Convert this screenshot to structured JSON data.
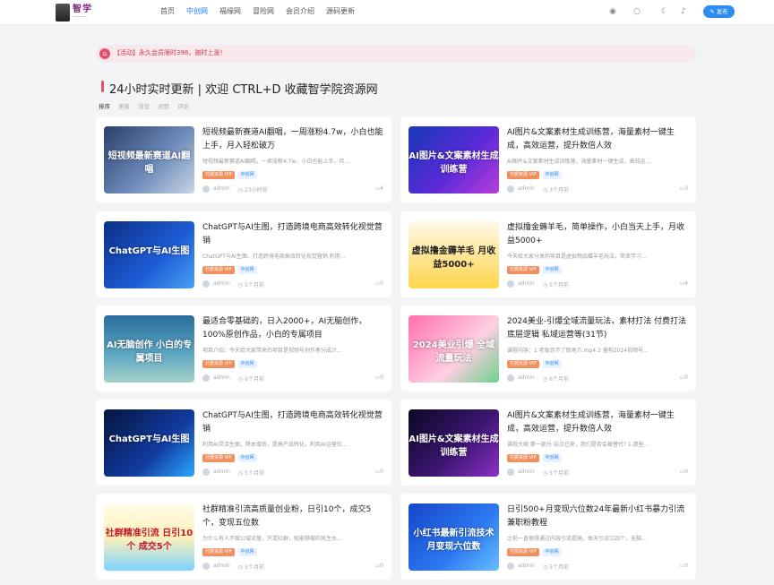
{
  "header": {
    "nav": [
      "首页",
      "中创网",
      "福缘网",
      "冒险网",
      "会员介绍",
      "源码更新"
    ],
    "active_nav_index": 1,
    "post_button": "发布",
    "icons": [
      "user-icon",
      "search-icon",
      "moon-icon",
      "bell-icon"
    ]
  },
  "notice": {
    "text": "【活动】永久会员限时398，随时上涨！"
  },
  "section": {
    "title": "24小时实时更新 | 欢迎 CTRL+D 收藏智学院资源网",
    "sorts": [
      "排序",
      "更新",
      "浏览",
      "点赞",
      "评论"
    ]
  },
  "posts": [
    {
      "title": "短视频最新赛道AI翻唱，一周涨粉4.7w，小白也能上手，月入轻松破万",
      "thumb": "短视频最新赛道AI翻唱",
      "desc": "短视频最新赛道AI翻唱，一周涨粉4.7w，小白也能上手，月...",
      "tag1": "付费资源 VIP",
      "tag2": "中创网",
      "author": "admin",
      "time": "23小时前",
      "count": "4"
    },
    {
      "title": "AI图片&文案素材生成训练营，海量素材一键生成，高效运营，提升数倍人效",
      "thumb": "AI图片&文案素材生成训练营",
      "desc": "AI图片&文案素材生成训练营，海量素材一键生成，高效运...",
      "tag1": "付费资源 VIP",
      "tag2": "中创网",
      "author": "admin",
      "time": "3个月前",
      "count": "3"
    },
    {
      "title": "ChatGPT与AI生图，打造跨境电商高效转化视觉营销",
      "thumb": "ChatGPT与AI生图",
      "desc": "ChatGPT与AI生图，打造跨境电商高效转化视觉营销 利用...",
      "tag1": "付费资源 VIP",
      "tag2": "中创网",
      "author": "admin",
      "time": "5个月前",
      "count": "0"
    },
    {
      "title": "虚拟撸金薅羊毛，简单操作，小白当天上手，月收益5000+",
      "thumb": "虚拟撸金薅羊毛 月收益5000+",
      "desc": "今天给大家分享的项目是虚拟物品薅羊毛玩法，简单学习...",
      "tag1": "付费资源 VIP",
      "tag2": "中创网",
      "author": "admin",
      "time": "5个月前",
      "count": "4"
    },
    {
      "title": "最适合零基础的，日入2000+，AI无脑创作，100%原创作品，小白的专属项目",
      "thumb": "AI无脑创作 小白的专属项目",
      "desc": "项目介绍：今天给大家带来的项目是视频号创作者分成计...",
      "tag1": "付费资源 VIP",
      "tag2": "中创网",
      "author": "admin",
      "time": "6个月前",
      "count": "0"
    },
    {
      "title": "2024美业-引爆全域流量玩法，素材打法 付费打法 底层逻辑 私域运营等(31节)",
      "thumb": "2024美业引爆 全域流量玩法",
      "desc": "课程内容：1 老板到不了新地方.mp4 2 量构2024视频号...",
      "tag1": "付费资源 VIP",
      "tag2": "中创网",
      "author": "admin",
      "time": "6个月前",
      "count": "0"
    },
    {
      "title": "ChatGPT与AI生图，打造跨境电商高效转化视觉营销",
      "thumb": "ChatGPT与AI生图",
      "desc": "利用AI灵活生图，降本增效，提高产品转化，利用AI运营社...",
      "tag1": "付费资源 VIP",
      "tag2": "中创网",
      "author": "admin",
      "time": "5个月前",
      "count": "0"
    },
    {
      "title": "AI图片&文案素材生成训练营，海量素材一键生成，高效运营，提升数倍人效",
      "thumb": "AI图片&文案素材生成训练营",
      "desc": "课程大纲 第一部分 启点已来，我们是否会被替代? 1.那些...",
      "tag1": "付费资源 VIP",
      "tag2": "中创网",
      "author": "admin",
      "time": "5个月前",
      "count": "0"
    },
    {
      "title": "社群精准引流高质量创业粉，日引10个，成交5个，变现五位数",
      "thumb": "社群精准引流 日引10个 成交5个",
      "desc": "为什么有人不做公域流量，只混社群，就能够做的风生水...",
      "tag1": "付费资源 VIP",
      "tag2": "中创网",
      "author": "admin",
      "time": "5个月前",
      "count": "0"
    },
    {
      "title": "日引500+月变现六位数24年最新小红书暴力引流兼职粉教程",
      "thumb": "小红书最新引流技术 月变现六位数",
      "desc": "之前一直很得通过内容引流提高，每天引流三四个，无脑...",
      "tag1": "付费资源 VIP",
      "tag2": "中创网",
      "author": "admin",
      "time": "5个月前",
      "count": "0"
    }
  ]
}
